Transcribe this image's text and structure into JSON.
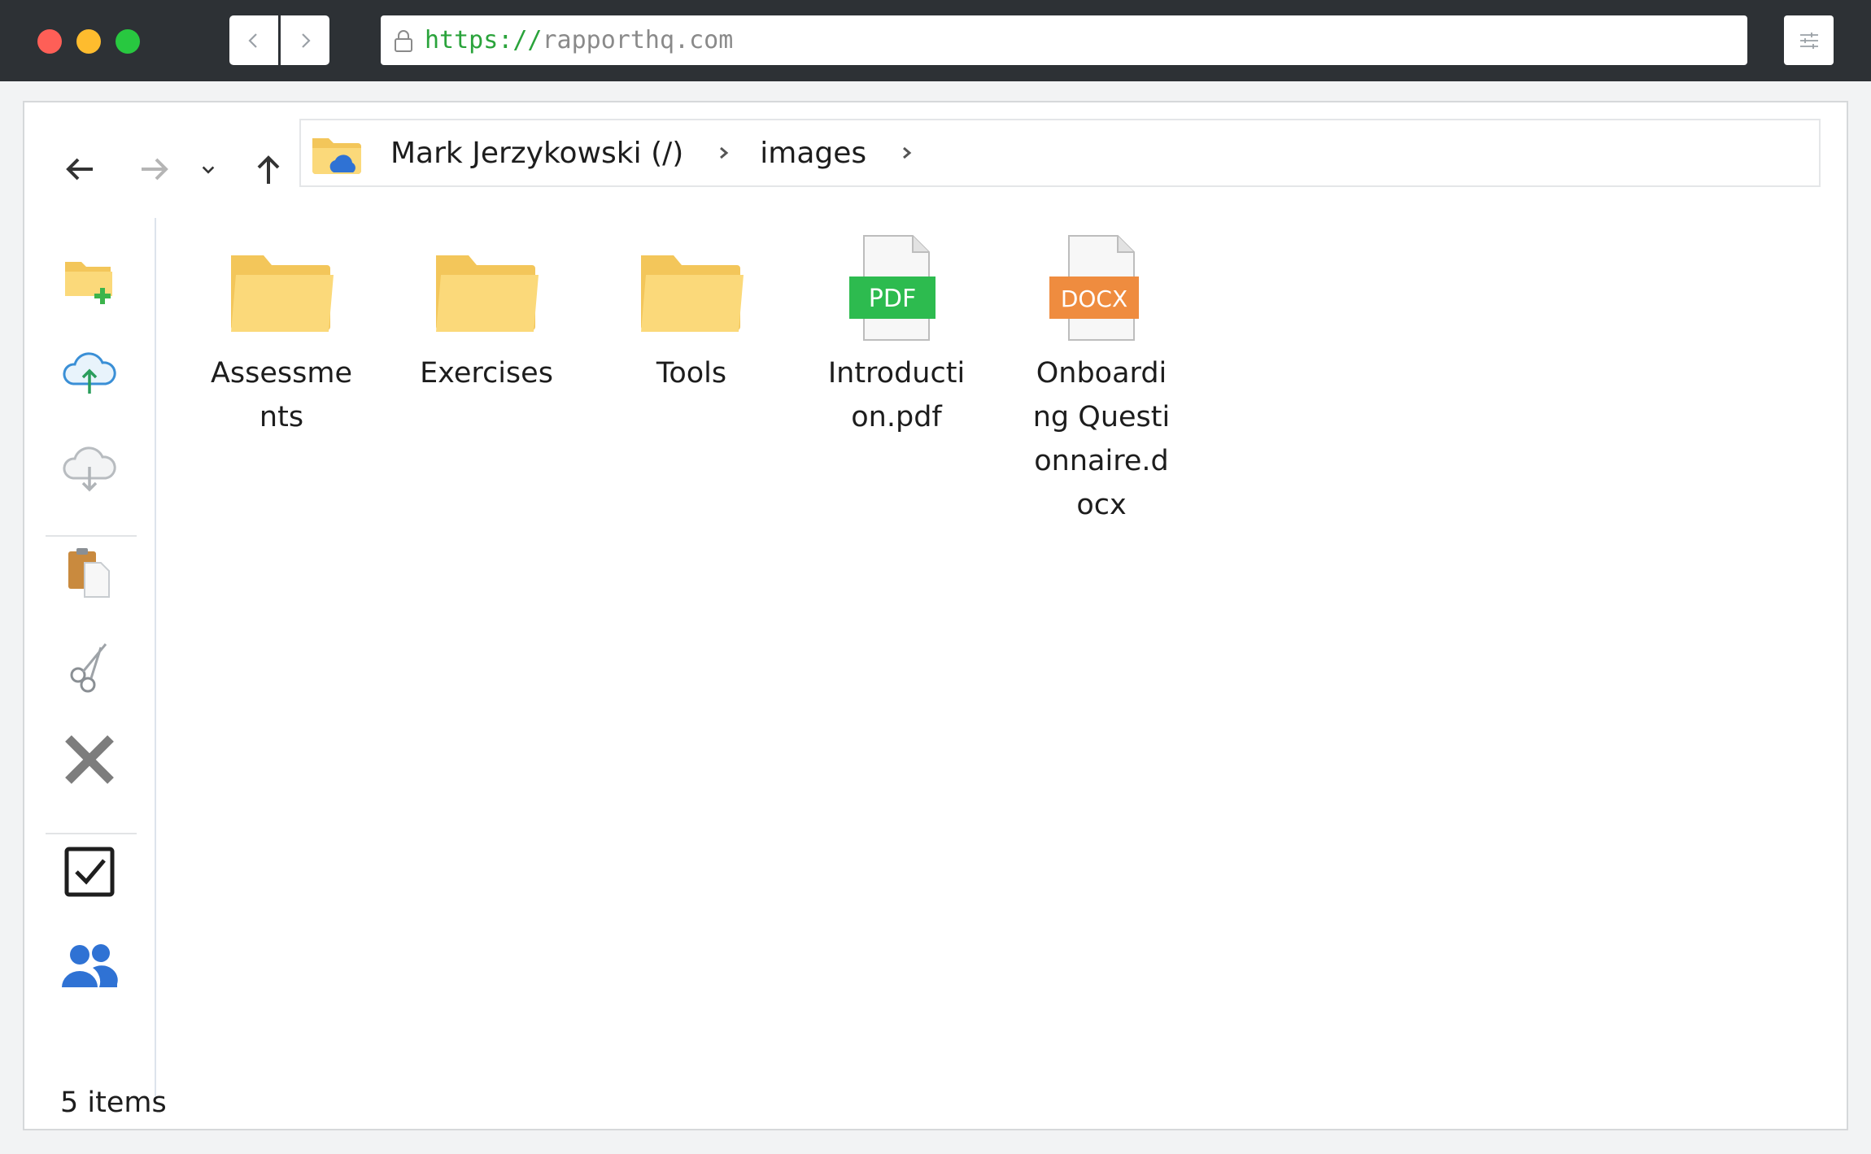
{
  "browser": {
    "url_scheme": "https://",
    "url_host": "rapporthq.com"
  },
  "breadcrumb": {
    "items": [
      "Mark Jerzykowski (/)",
      "images"
    ]
  },
  "files": [
    {
      "name": "Assessments",
      "type": "folder"
    },
    {
      "name": "Exercises",
      "type": "folder"
    },
    {
      "name": "Tools",
      "type": "folder"
    },
    {
      "name": "Introduction.pdf",
      "type": "pdf",
      "badge": "PDF"
    },
    {
      "name": "Onboarding Questionnaire.docx",
      "type": "docx",
      "badge": "DOCX"
    }
  ],
  "status": {
    "count_text": "5 items"
  },
  "colors": {
    "pdf_badge": "#2dbb4f",
    "docx_badge": "#ef8c3f",
    "folder": "#fbd97a",
    "accent_blue": "#2f72d4"
  },
  "icons": {
    "toolbar": [
      "back-arrow-icon",
      "forward-arrow-icon",
      "history-dropdown-icon",
      "up-arrow-icon"
    ],
    "sidebar": [
      "new-folder-icon",
      "upload-icon",
      "download-icon",
      "paste-icon",
      "cut-icon",
      "delete-icon",
      "select-all-icon",
      "users-icon"
    ]
  }
}
